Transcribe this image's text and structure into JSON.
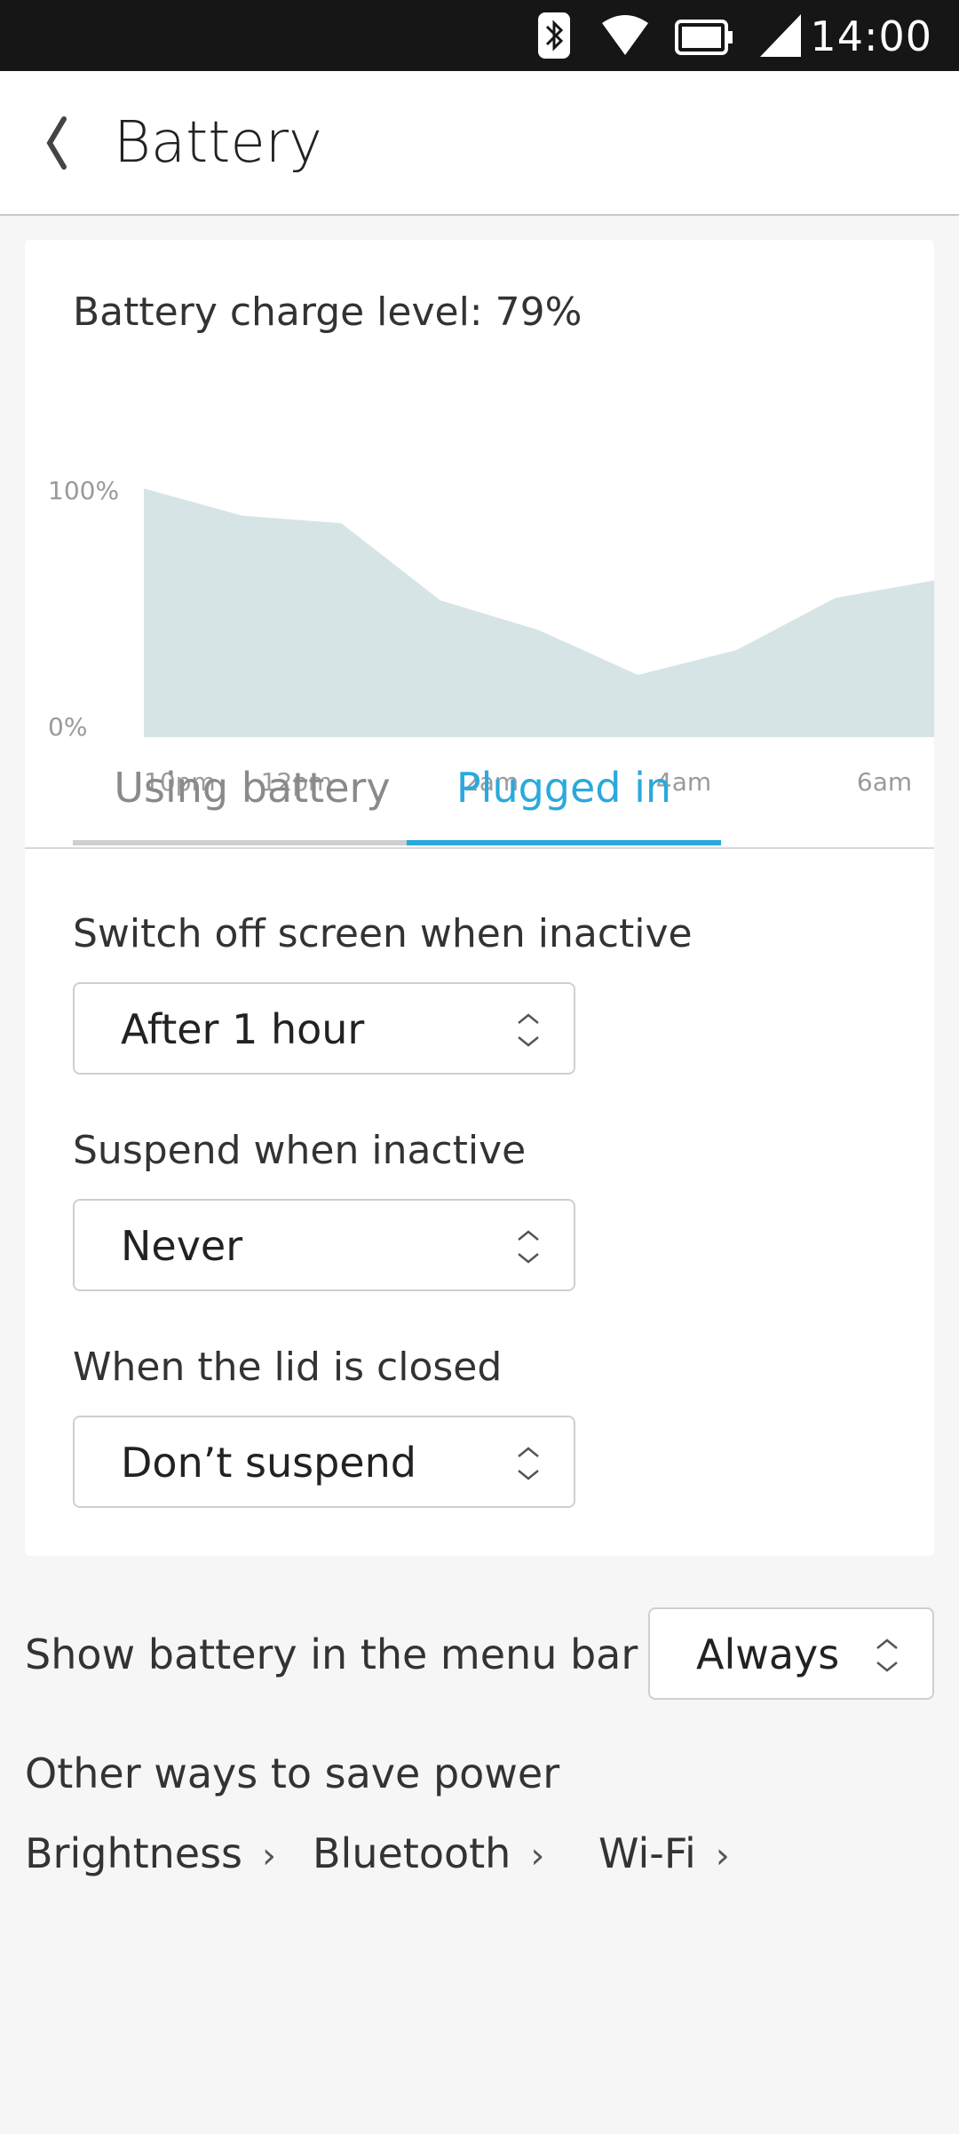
{
  "status_bar": {
    "time": "14:00",
    "icons": [
      "bluetooth-icon",
      "wifi-icon",
      "battery-icon",
      "signal-icon"
    ]
  },
  "header": {
    "title": "Battery",
    "back_icon": "back-chevron-icon"
  },
  "charge": {
    "label": "Battery charge level: 79%"
  },
  "chart_data": {
    "type": "area",
    "y_ticks": [
      "100%",
      "0%"
    ],
    "x_ticks": [
      "10pm",
      "12pm",
      "2am",
      "4am",
      "6am"
    ],
    "ylim": [
      0,
      100
    ],
    "values": [
      100,
      89,
      86,
      55,
      43,
      25,
      35,
      56,
      63
    ],
    "fill_color": "#d7e4e6",
    "tick_color": "#9a9a9a"
  },
  "tabs": {
    "using_battery": "Using battery",
    "plugged_in": "Plugged in",
    "active": "plugged_in",
    "accent_color": "#2aa9dd"
  },
  "settings": {
    "screen_off": {
      "label": "Switch off screen when inactive",
      "value": "After 1 hour"
    },
    "suspend": {
      "label": "Suspend when inactive",
      "value": "Never"
    },
    "lid": {
      "label": "When the lid is closed",
      "value": "Don’t suspend"
    }
  },
  "menu_bar": {
    "label": "Show battery in the menu bar",
    "value": "Always"
  },
  "other": {
    "title": "Other ways to save power",
    "links": [
      "Brightness",
      "Bluetooth",
      "Wi-Fi"
    ]
  }
}
